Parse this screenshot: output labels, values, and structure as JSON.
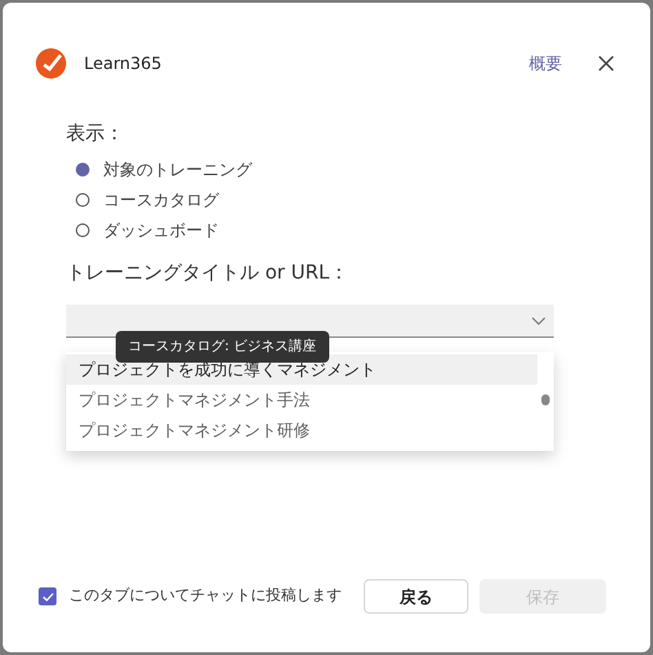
{
  "header": {
    "app_name": "Learn365",
    "about_link": "概要"
  },
  "display": {
    "label": "表示：",
    "options": [
      {
        "label": "対象のトレーニング",
        "selected": true
      },
      {
        "label": "コースカタログ",
        "selected": false
      },
      {
        "label": "ダッシュボード",
        "selected": false
      }
    ]
  },
  "training": {
    "label": "トレーニングタイトル or URL：",
    "tooltip": "コースカタログ: ビジネス講座",
    "results": [
      {
        "label": "プロジェクトを成功に導くマネジメント",
        "selected": true
      },
      {
        "label": "プロジェクトマネジメント手法",
        "selected": false
      },
      {
        "label": "プロジェクトマネジメント研修",
        "selected": false
      }
    ]
  },
  "footer": {
    "post_to_chat": {
      "label": "このタブについてチャットに投稿します",
      "checked": true
    },
    "back_button": {
      "label": "戻る",
      "disabled": false
    },
    "save_button": {
      "label": "保存",
      "disabled": true
    }
  }
}
